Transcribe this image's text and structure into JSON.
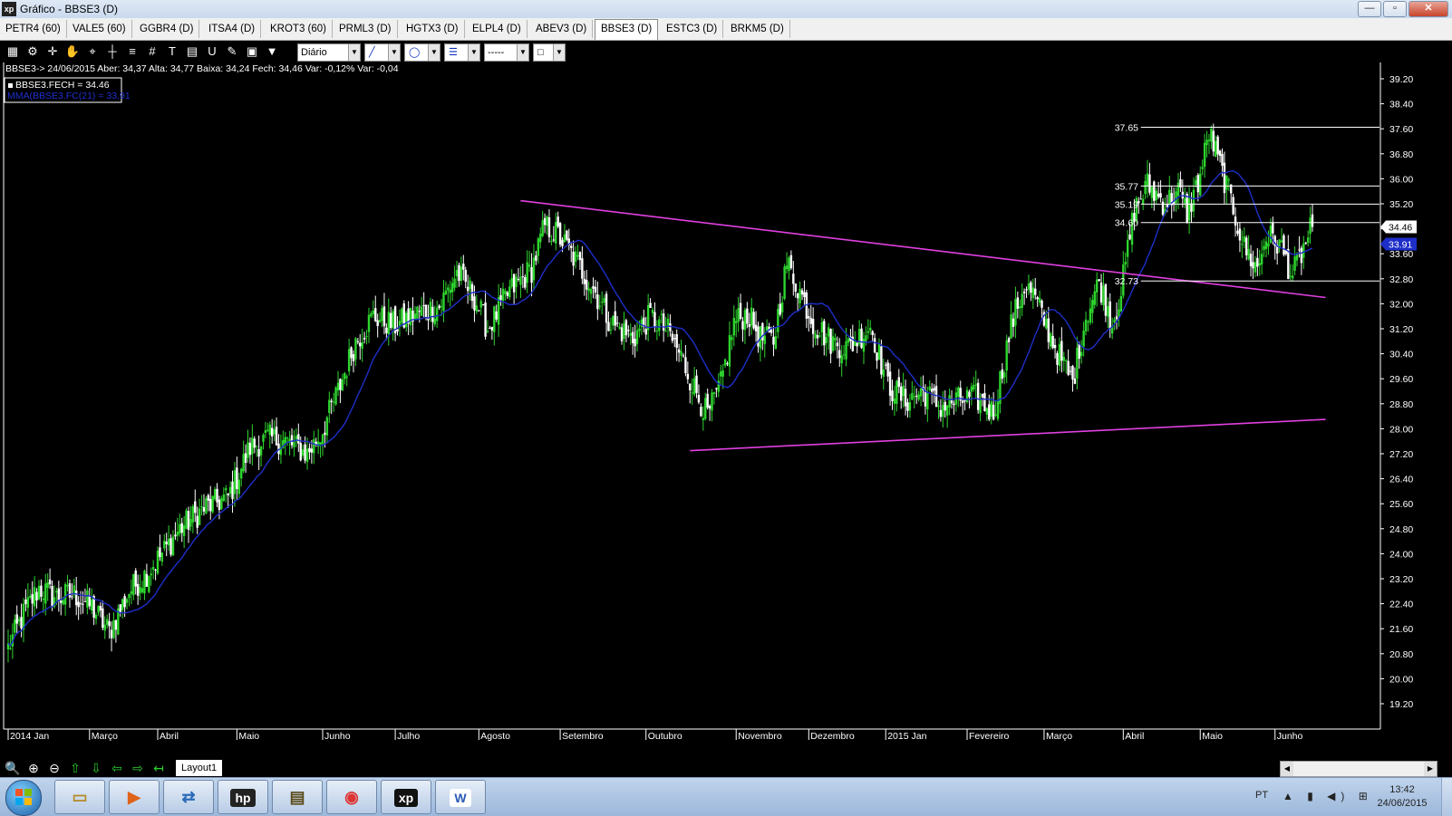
{
  "window": {
    "title": "Gráfico - BBSE3 (D)",
    "app_icon_text": "xp",
    "buttons": {
      "minimize": "—",
      "maximize": "▫",
      "close": "✕"
    }
  },
  "tabs": [
    {
      "label": "PETR4 (60)",
      "active": false
    },
    {
      "label": "VALE5 (60)",
      "active": false
    },
    {
      "label": "GGBR4 (D)",
      "active": false
    },
    {
      "label": "ITSA4 (D)",
      "active": false
    },
    {
      "label": "KROT3 (60)",
      "active": false
    },
    {
      "label": "PRML3 (D)",
      "active": false
    },
    {
      "label": "HGTX3 (D)",
      "active": false
    },
    {
      "label": "ELPL4 (D)",
      "active": false
    },
    {
      "label": "ABEV3 (D)",
      "active": false
    },
    {
      "label": "BBSE3 (D)",
      "active": true
    },
    {
      "label": "ESTC3 (D)",
      "active": false
    },
    {
      "label": "BRKM5 (D)",
      "active": false
    }
  ],
  "toolbar": {
    "tools": [
      "chart-settings-icon",
      "gear-icon",
      "crosshair-cursor-icon",
      "hand-icon",
      "zoom-area-icon",
      "crosshair-icon",
      "fibonacci-icon",
      "grid-icon",
      "text-tool-icon",
      "calculator-icon",
      "magnet-icon",
      "eraser-icon",
      "clipboard-icon",
      "filter-icon"
    ],
    "tool_glyphs": [
      "▦",
      "⚙",
      "✛",
      "✋",
      "⌖",
      "┼",
      "≡",
      "#",
      "T",
      "▤",
      "U",
      "✎",
      "▣",
      "▼"
    ],
    "periodicity": "Diário",
    "line_glyph": "╱",
    "circle_glyph": "◯",
    "thickness_glyph": "☰",
    "dash_glyph": "-----",
    "color_glyph": "□"
  },
  "quote_line": "BBSE3-> 24/06/2015 Aber: 34,37 Alta: 34,77 Baixa: 34,24 Fech: 34,46 Var: -0,12% Var: -0,04",
  "legend": {
    "close_label": "BBSE3.FECH = 34.46",
    "ma_label": "MMA(BBSE3.FC(21) = 33.91"
  },
  "colors": {
    "background": "#000000",
    "up_candle": "#2ed52e",
    "down_candle": "#ffffff",
    "moving_average": "#1e2ec8",
    "trendline": "#e040e0",
    "level_line": "#ffffff",
    "axis_text": "#ffffff",
    "last_price_tag": "#ffffff",
    "ma_tag": "#1e2ec8"
  },
  "chart_data": {
    "type": "candlestick",
    "symbol": "BBSE3",
    "periodicity": "Diário",
    "date_range": [
      "2014-01-02",
      "2015-06-24"
    ],
    "ylim": [
      18.6,
      39.4
    ],
    "y_ticks": [
      "39.20",
      "38.40",
      "37.60",
      "36.80",
      "36.00",
      "35.20",
      "34.40",
      "33.60",
      "32.80",
      "32.00",
      "31.20",
      "30.40",
      "29.60",
      "28.80",
      "28.00",
      "27.20",
      "26.40",
      "25.60",
      "24.80",
      "24.00",
      "23.20",
      "22.40",
      "21.60",
      "20.80",
      "20.00",
      "19.20"
    ],
    "x_labels": [
      {
        "label": "2014 Jan",
        "index": 0
      },
      {
        "label": "Março",
        "index": 37
      },
      {
        "label": "Abril",
        "index": 68
      },
      {
        "label": "Maio",
        "index": 104
      },
      {
        "label": "Junho",
        "index": 143
      },
      {
        "label": "Julho",
        "index": 176
      },
      {
        "label": "Agosto",
        "index": 214
      },
      {
        "label": "Setembro",
        "index": 251
      },
      {
        "label": "Outubro",
        "index": 290
      },
      {
        "label": "Novembro",
        "index": 331
      },
      {
        "label": "Dezembro",
        "index": 364
      },
      {
        "label": "2015 Jan",
        "index": 399
      },
      {
        "label": "Fevereiro",
        "index": 436
      },
      {
        "label": "Março",
        "index": 471
      },
      {
        "label": "Abril",
        "index": 507
      },
      {
        "label": "Maio",
        "index": 542
      },
      {
        "label": "Junho",
        "index": 576
      }
    ],
    "anchors": [
      [
        0,
        21.0
      ],
      [
        8,
        22.2
      ],
      [
        14,
        22.9
      ],
      [
        22,
        22.6
      ],
      [
        30,
        22.7
      ],
      [
        38,
        22.3
      ],
      [
        46,
        21.5
      ],
      [
        55,
        22.8
      ],
      [
        62,
        23.3
      ],
      [
        70,
        24.0
      ],
      [
        78,
        24.8
      ],
      [
        90,
        25.5
      ],
      [
        100,
        25.8
      ],
      [
        110,
        27.4
      ],
      [
        118,
        27.7
      ],
      [
        126,
        27.6
      ],
      [
        136,
        27.2
      ],
      [
        142,
        27.8
      ],
      [
        150,
        29.2
      ],
      [
        158,
        30.8
      ],
      [
        166,
        31.6
      ],
      [
        176,
        31.3
      ],
      [
        186,
        31.7
      ],
      [
        196,
        31.9
      ],
      [
        204,
        33.0
      ],
      [
        212,
        32.2
      ],
      [
        218,
        31.2
      ],
      [
        228,
        32.4
      ],
      [
        238,
        33.1
      ],
      [
        244,
        34.5
      ],
      [
        250,
        34.2
      ],
      [
        256,
        33.6
      ],
      [
        266,
        32.5
      ],
      [
        274,
        31.4
      ],
      [
        284,
        30.9
      ],
      [
        292,
        31.6
      ],
      [
        300,
        31.1
      ],
      [
        306,
        30.3
      ],
      [
        312,
        29.3
      ],
      [
        318,
        28.4
      ],
      [
        324,
        29.4
      ],
      [
        330,
        31.4
      ],
      [
        336,
        31.7
      ],
      [
        342,
        30.9
      ],
      [
        348,
        30.8
      ],
      [
        354,
        33.3
      ],
      [
        360,
        32.4
      ],
      [
        366,
        31.4
      ],
      [
        374,
        30.8
      ],
      [
        382,
        30.6
      ],
      [
        392,
        31.3
      ],
      [
        400,
        29.4
      ],
      [
        408,
        28.9
      ],
      [
        416,
        29.2
      ],
      [
        424,
        28.7
      ],
      [
        432,
        28.9
      ],
      [
        440,
        29.0
      ],
      [
        448,
        28.5
      ],
      [
        456,
        31.3
      ],
      [
        462,
        32.6
      ],
      [
        466,
        32.3
      ],
      [
        472,
        31.3
      ],
      [
        478,
        30.3
      ],
      [
        484,
        29.5
      ],
      [
        490,
        31.6
      ],
      [
        496,
        32.7
      ],
      [
        502,
        31.4
      ],
      [
        506,
        32.4
      ],
      [
        512,
        35.0
      ],
      [
        518,
        35.8
      ],
      [
        526,
        35.2
      ],
      [
        532,
        35.6
      ],
      [
        536,
        34.9
      ],
      [
        542,
        36.1
      ],
      [
        546,
        37.5
      ],
      [
        552,
        36.2
      ],
      [
        556,
        35.3
      ],
      [
        562,
        33.8
      ],
      [
        568,
        33.1
      ],
      [
        572,
        34.2
      ],
      [
        578,
        33.9
      ],
      [
        584,
        32.9
      ],
      [
        588,
        33.6
      ],
      [
        593,
        34.5
      ]
    ],
    "moving_average": {
      "name": "MMA(BBSE3.FC(21)",
      "period": 21,
      "last": 33.91
    },
    "last_close": 34.46,
    "trendlines": [
      {
        "start": {
          "index": 233,
          "value": 35.3
        },
        "end": {
          "index": 599,
          "value": 32.2
        }
      },
      {
        "start": {
          "index": 310,
          "value": 27.3
        },
        "end": {
          "index": 599,
          "value": 28.3
        }
      }
    ],
    "levels": [
      {
        "label": "37.65",
        "value": 37.65,
        "start_index": 515
      },
      {
        "label": "35.77",
        "value": 35.77,
        "start_index": 515
      },
      {
        "label": "35.19",
        "value": 35.19,
        "start_index": 515
      },
      {
        "label": "34.60",
        "value": 34.6,
        "start_index": 515
      },
      {
        "label": "32.73",
        "value": 32.73,
        "start_index": 515
      }
    ],
    "price_tags": [
      {
        "label": "34.46",
        "value": 34.46,
        "style": "last"
      },
      {
        "label": "33.91",
        "value": 33.91,
        "style": "ma"
      }
    ]
  },
  "bottom": {
    "layout_tab": "Layout1",
    "nav_glyphs": [
      "🔍",
      "⊕",
      "⊖",
      "⇧",
      "⇩",
      "⇦",
      "⇨",
      "↤"
    ]
  },
  "taskbar": {
    "apps": [
      {
        "name": "file-explorer",
        "glyph": "▭"
      },
      {
        "name": "media-player",
        "glyph": "▶"
      },
      {
        "name": "network-app",
        "glyph": "⇄"
      },
      {
        "name": "hp-app",
        "glyph": "hp"
      },
      {
        "name": "scanner-app",
        "glyph": "▤"
      },
      {
        "name": "chrome",
        "glyph": "◉"
      },
      {
        "name": "xp-app",
        "glyph": "xp"
      },
      {
        "name": "word",
        "glyph": "W"
      }
    ],
    "language": "PT",
    "tray_glyphs": "▲ ▮ ◀) ⊞",
    "time": "13:42",
    "date": "24/06/2015"
  }
}
